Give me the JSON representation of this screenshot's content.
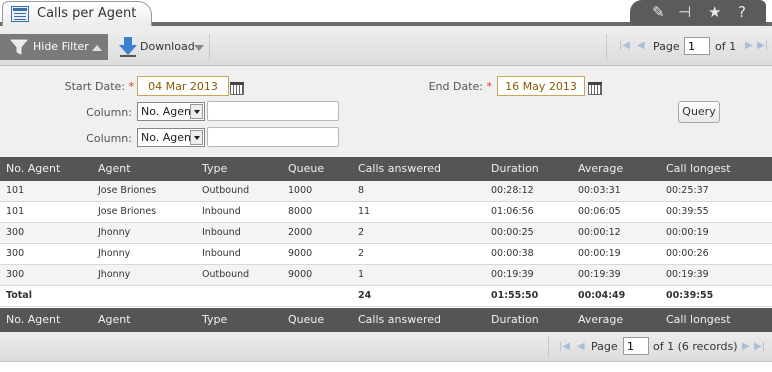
{
  "window": {
    "title": "Calls per Agent",
    "tools": [
      "edit-icon",
      "collapse-icon",
      "star-icon",
      "help-icon"
    ],
    "tool_glyphs": [
      "✎",
      "⊣",
      "★",
      "?"
    ]
  },
  "toolbar": {
    "hide_filter_label": "Hide Filter",
    "download_label": "Download",
    "pager": {
      "page_label": "Page",
      "page_value": "1",
      "of_label": "of 1"
    }
  },
  "filter": {
    "start_date_label": "Start Date:",
    "start_date_value": "04 Mar 2013",
    "end_date_label": "End Date:",
    "end_date_value": "16 May 2013",
    "required_mark": "*",
    "column1_label": "Column:",
    "column1_select": "No. Agent",
    "column1_value": "",
    "column2_label": "Column:",
    "column2_select": "No. Agent",
    "column2_value": "",
    "query_label": "Query"
  },
  "table": {
    "columns": [
      "No. Agent",
      "Agent",
      "Type",
      "Queue",
      "Calls answered",
      "Duration",
      "Average",
      "Call longest"
    ],
    "rows": [
      [
        "101",
        "Jose Briones",
        "Outbound",
        "1000",
        "8",
        "00:28:12",
        "00:03:31",
        "00:25:37"
      ],
      [
        "101",
        "Jose Briones",
        "Inbound",
        "8000",
        "11",
        "01:06:56",
        "00:06:05",
        "00:39:55"
      ],
      [
        "300",
        "Jhonny",
        "Inbound",
        "2000",
        "2",
        "00:00:25",
        "00:00:12",
        "00:00:19"
      ],
      [
        "300",
        "Jhonny",
        "Inbound",
        "9000",
        "2",
        "00:00:38",
        "00:00:19",
        "00:00:26"
      ],
      [
        "300",
        "Jhonny",
        "Outbound",
        "9000",
        "1",
        "00:19:39",
        "00:19:39",
        "00:19:39"
      ]
    ],
    "total": [
      "Total",
      "",
      "",
      "",
      "24",
      "01:55:50",
      "00:04:49",
      "00:39:55"
    ]
  },
  "bottom_pager": {
    "page_label": "Page",
    "page_value": "1",
    "of_label": "of 1 (6 records)"
  },
  "colors": {
    "header_bg": "#555555",
    "required": "#dd3333",
    "date_text": "#8a5a00"
  }
}
